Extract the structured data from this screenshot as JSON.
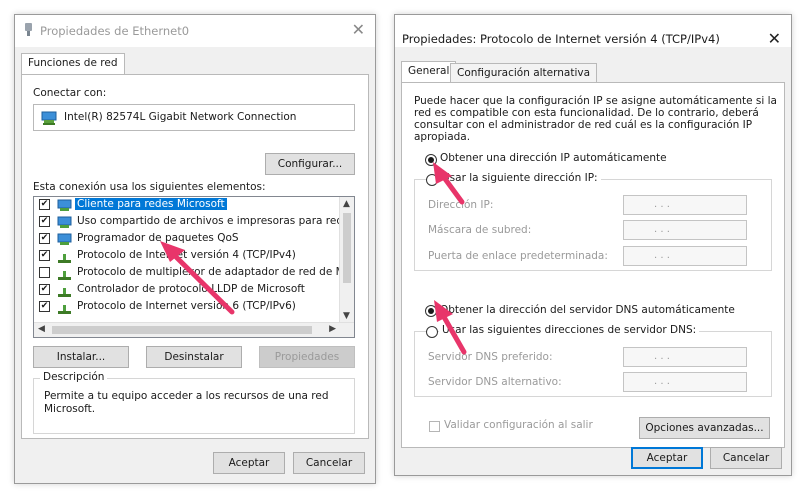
{
  "left_window": {
    "title": "Propiedades de Ethernet0",
    "tab": "Funciones de red",
    "connect_label": "Conectar con:",
    "adapter": "Intel(R) 82574L Gigabit Network Connection",
    "configure_button": "Configurar...",
    "items_label": "Esta conexión usa los siguientes elementos:",
    "items": [
      {
        "label": "Cliente para redes Microsoft",
        "checked": true,
        "selected": true,
        "icon": "network-client-icon"
      },
      {
        "label": "Uso compartido de archivos e impresoras para redes M",
        "checked": true,
        "icon": "file-sharing-icon"
      },
      {
        "label": "Programador de paquetes QoS",
        "checked": true,
        "icon": "network-service-icon"
      },
      {
        "label": "Protocolo de Internet versión 4 (TCP/IPv4)",
        "checked": true,
        "icon": "protocol-icon"
      },
      {
        "label": "Protocolo de multiplexor de adaptador de red de Micros",
        "checked": false,
        "icon": "protocol-icon"
      },
      {
        "label": "Controlador de protocolo LLDP de Microsoft",
        "checked": true,
        "icon": "protocol-icon"
      },
      {
        "label": "Protocolo de Internet versión 6 (TCP/IPv6)",
        "checked": true,
        "icon": "protocol-icon"
      }
    ],
    "install_button": "Instalar...",
    "uninstall_button": "Desinstalar",
    "properties_button": "Propiedades",
    "description_legend": "Descripción",
    "description_text_1": "Permite a tu equipo acceder a los recursos de una red",
    "description_text_2": "Microsoft.",
    "ok_button": "Aceptar",
    "cancel_button": "Cancelar"
  },
  "right_window": {
    "title": "Propiedades: Protocolo de Internet versión 4 (TCP/IPv4)",
    "tabs": [
      "General",
      "Configuración alternativa"
    ],
    "intro_lines": [
      "Puede hacer que la configuración IP se asigne automáticamente si la",
      "red es compatible con esta funcionalidad. De lo contrario, deberá",
      "consultar con el administrador de red cuál es la configuración IP",
      "apropiada."
    ],
    "radio_auto_ip": "Obtener una dirección IP automáticamente",
    "radio_manual_ip": "Usar la siguiente dirección IP:",
    "ip_address_label": "Dirección IP:",
    "subnet_mask_label": "Máscara de subred:",
    "gateway_label": "Puerta de enlace predeterminada:",
    "radio_auto_dns": "Obtener la dirección del servidor DNS automáticamente",
    "radio_manual_dns": "Usar las siguientes direcciones de servidor DNS:",
    "preferred_dns_label": "Servidor DNS preferido:",
    "alternate_dns_label": "Servidor DNS alternativo:",
    "ip_placeholder": ".        .        .",
    "validate_label": "Validar configuración al salir",
    "advanced_button": "Opciones avanzadas...",
    "ok_button": "Aceptar",
    "cancel_button": "Cancelar",
    "selected": {
      "ip_mode": "auto",
      "dns_mode": "auto"
    }
  },
  "colors": {
    "selection_blue": "#0078d7",
    "annotation_arrow": "#e8356a",
    "window_bg": "#f0f0f0"
  },
  "close_glyph": "✕",
  "check_glyph": "✔"
}
